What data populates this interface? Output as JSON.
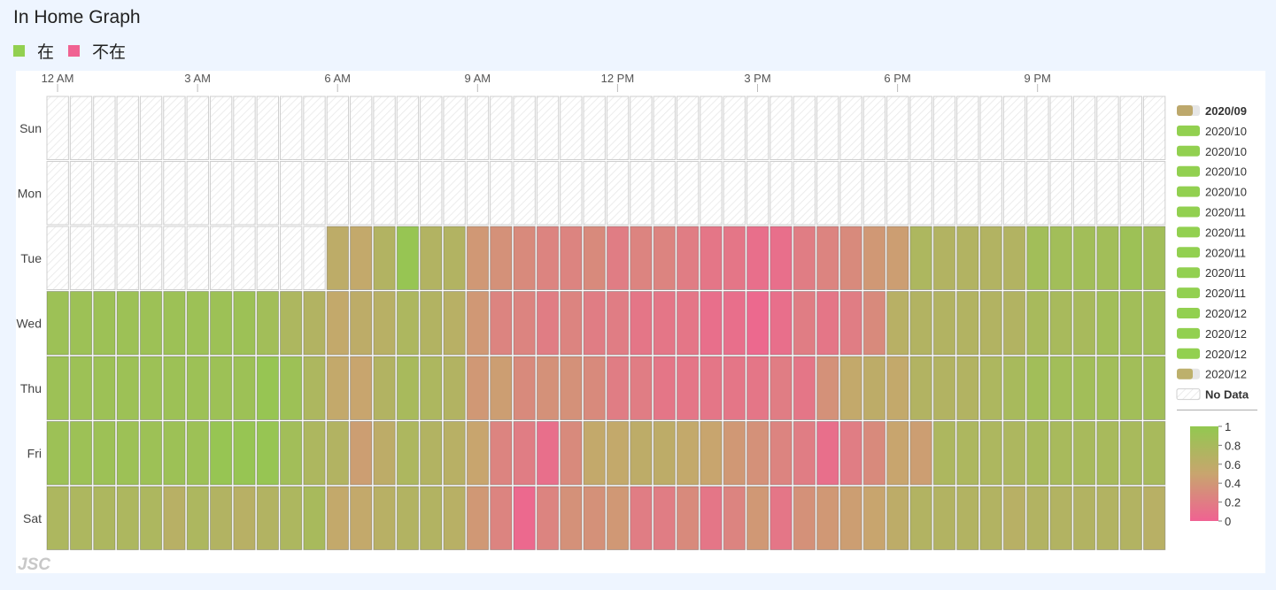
{
  "page": {
    "title": "In Home Graph",
    "legend": [
      {
        "label": "在",
        "color": "#92d050"
      },
      {
        "label": "不在",
        "color": "#f06292"
      }
    ]
  },
  "chart_data": {
    "type": "heatmap",
    "title": "In Home Graph",
    "x_tick_labels": [
      "12 AM",
      "3 AM",
      "6 AM",
      "9 AM",
      "12 PM",
      "3 PM",
      "6 PM",
      "9 PM"
    ],
    "y_categories": [
      "Sun",
      "Mon",
      "Tue",
      "Wed",
      "Thu",
      "Fri",
      "Sat"
    ],
    "columns_per_row": 48,
    "value_range": [
      0,
      1
    ],
    "colorbar_ticks": [
      "1",
      "0.8",
      "0.6",
      "0.4",
      "0.2",
      "0"
    ],
    "color_scale": {
      "low": "#f06292",
      "mid": "#c8a56e",
      "high": "#92c850"
    },
    "no_data_label": "No Data",
    "values": [
      [
        null,
        null,
        null,
        null,
        null,
        null,
        null,
        null,
        null,
        null,
        null,
        null,
        null,
        null,
        null,
        null,
        null,
        null,
        null,
        null,
        null,
        null,
        null,
        null,
        null,
        null,
        null,
        null,
        null,
        null,
        null,
        null,
        null,
        null,
        null,
        null,
        null,
        null,
        null,
        null,
        null,
        null,
        null,
        null,
        null,
        null,
        null,
        null
      ],
      [
        null,
        null,
        null,
        null,
        null,
        null,
        null,
        null,
        null,
        null,
        null,
        null,
        null,
        null,
        null,
        null,
        null,
        null,
        null,
        null,
        null,
        null,
        null,
        null,
        null,
        null,
        null,
        null,
        null,
        null,
        null,
        null,
        null,
        null,
        null,
        null,
        null,
        null,
        null,
        null,
        null,
        null,
        null,
        null,
        null,
        null,
        null,
        null
      ],
      [
        null,
        null,
        null,
        null,
        null,
        null,
        null,
        null,
        null,
        null,
        null,
        null,
        0.6,
        0.55,
        0.7,
        0.95,
        0.7,
        0.7,
        0.4,
        0.35,
        0.3,
        0.25,
        0.25,
        0.3,
        0.2,
        0.25,
        0.25,
        0.2,
        0.15,
        0.15,
        0.1,
        0.1,
        0.2,
        0.25,
        0.3,
        0.4,
        0.45,
        0.75,
        0.7,
        0.7,
        0.7,
        0.7,
        0.85,
        0.85,
        0.85,
        0.85,
        0.9,
        0.85
      ],
      [
        0.9,
        0.9,
        0.9,
        0.9,
        0.9,
        0.9,
        0.9,
        0.9,
        0.9,
        0.85,
        0.75,
        0.7,
        0.55,
        0.6,
        0.65,
        0.75,
        0.7,
        0.65,
        0.4,
        0.25,
        0.25,
        0.2,
        0.25,
        0.2,
        0.2,
        0.15,
        0.15,
        0.15,
        0.1,
        0.1,
        0.05,
        0.1,
        0.2,
        0.15,
        0.2,
        0.3,
        0.65,
        0.7,
        0.7,
        0.7,
        0.7,
        0.7,
        0.8,
        0.8,
        0.8,
        0.85,
        0.85,
        0.85
      ],
      [
        0.9,
        0.9,
        0.9,
        0.9,
        0.9,
        0.9,
        0.9,
        0.9,
        0.9,
        0.95,
        0.9,
        0.75,
        0.55,
        0.5,
        0.7,
        0.8,
        0.75,
        0.7,
        0.4,
        0.45,
        0.3,
        0.35,
        0.35,
        0.3,
        0.2,
        0.2,
        0.15,
        0.15,
        0.15,
        0.15,
        0.15,
        0.2,
        0.15,
        0.35,
        0.55,
        0.6,
        0.55,
        0.7,
        0.7,
        0.7,
        0.75,
        0.8,
        0.85,
        0.85,
        0.85,
        0.85,
        0.85,
        0.85
      ],
      [
        0.9,
        0.9,
        0.9,
        0.9,
        0.9,
        0.9,
        0.9,
        0.95,
        0.95,
        0.95,
        0.85,
        0.75,
        0.7,
        0.45,
        0.6,
        0.75,
        0.7,
        0.65,
        0.5,
        0.25,
        0.2,
        0.1,
        0.3,
        0.55,
        0.55,
        0.6,
        0.6,
        0.55,
        0.5,
        0.4,
        0.35,
        0.25,
        0.2,
        0.1,
        0.2,
        0.3,
        0.5,
        0.45,
        0.75,
        0.75,
        0.75,
        0.75,
        0.8,
        0.8,
        0.8,
        0.8,
        0.8,
        0.8
      ],
      [
        0.75,
        0.75,
        0.75,
        0.75,
        0.75,
        0.65,
        0.75,
        0.7,
        0.65,
        0.7,
        0.75,
        0.8,
        0.55,
        0.55,
        0.65,
        0.7,
        0.7,
        0.65,
        0.4,
        0.25,
        0.05,
        0.25,
        0.35,
        0.35,
        0.4,
        0.2,
        0.2,
        0.3,
        0.15,
        0.25,
        0.4,
        0.15,
        0.35,
        0.4,
        0.45,
        0.5,
        0.6,
        0.7,
        0.7,
        0.7,
        0.7,
        0.65,
        0.7,
        0.7,
        0.7,
        0.7,
        0.7,
        0.65
      ]
    ],
    "series": [
      {
        "name": "2020/09",
        "color": "#bda86c",
        "bold": true,
        "partial": true
      },
      {
        "name": "2020/10",
        "color": "#92d050"
      },
      {
        "name": "2020/10",
        "color": "#92d050"
      },
      {
        "name": "2020/10",
        "color": "#92d050"
      },
      {
        "name": "2020/10",
        "color": "#92d050"
      },
      {
        "name": "2020/11",
        "color": "#92d050"
      },
      {
        "name": "2020/11",
        "color": "#92d050"
      },
      {
        "name": "2020/11",
        "color": "#92d050"
      },
      {
        "name": "2020/11",
        "color": "#92d050"
      },
      {
        "name": "2020/11",
        "color": "#92d050"
      },
      {
        "name": "2020/12",
        "color": "#92d050"
      },
      {
        "name": "2020/12",
        "color": "#92d050"
      },
      {
        "name": "2020/12",
        "color": "#92d050"
      },
      {
        "name": "2020/12",
        "color": "#bdb06c",
        "partial": true
      }
    ],
    "watermark": "JSC"
  }
}
